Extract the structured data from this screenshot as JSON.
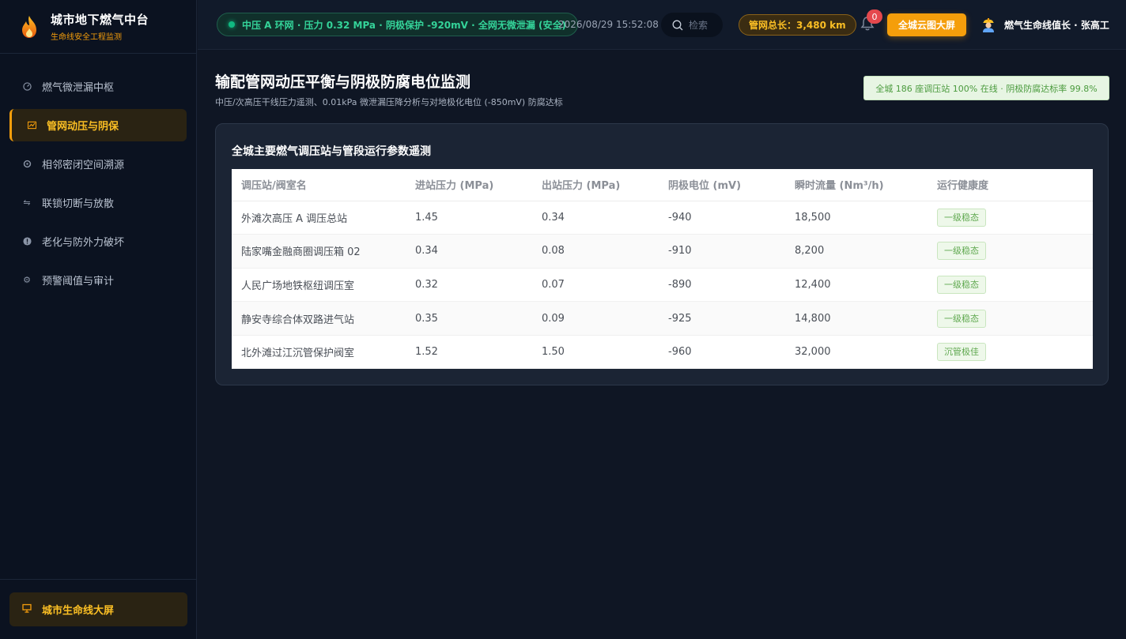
{
  "brand": {
    "title": "城市地下燃气中台",
    "subtitle": "生命线安全工程监测"
  },
  "sidebar": {
    "items": [
      {
        "label": "燃气微泄漏中枢",
        "icon": "gauge-icon",
        "active": false
      },
      {
        "label": "管网动压与阴保",
        "icon": "chart-icon",
        "active": true
      },
      {
        "label": "相邻密闭空间溯源",
        "icon": "crosshair-icon",
        "active": false
      },
      {
        "label": "联锁切断与放散",
        "icon": "swap-icon",
        "active": false
      },
      {
        "label": "老化与防外力破坏",
        "icon": "alert-icon",
        "active": false
      },
      {
        "label": "预警阈值与审计",
        "icon": "gear-icon",
        "active": false
      }
    ],
    "footer_button": "城市生命线大屏"
  },
  "header": {
    "status": "中压 A 环网 · 压力 0.32 MPa · 阴极保护 -920mV · 全网无微泄漏 (安全)",
    "timestamp": "2026/08/29 15:52:08",
    "search_placeholder": "检索",
    "pipe_length": "管网总长：3,480 km",
    "notifications": "0",
    "cloud_button": "全城云图大屏",
    "user": "燃气生命线值长 · 张高工"
  },
  "main": {
    "title": "输配管网动压平衡与阴极防腐电位监测",
    "subtitle": "中压/次高压干线压力遥测、0.01kPa 微泄漏压降分析与对地极化电位 (-850mV) 防腐达标",
    "online_badge": "全城 186 座调压站 100% 在线 · 阴极防腐达标率 99.8%",
    "panel_title": "全城主要燃气调压站与管段运行参数遥测",
    "table": {
      "headers": [
        "调压站/阀室名",
        "进站压力 (MPa)",
        "出站压力 (MPa)",
        "阴极电位 (mV)",
        "瞬时流量 (Nm³/h)",
        "运行健康度"
      ],
      "rows": [
        [
          "外滩次高压 A 调压总站",
          "1.45",
          "0.34",
          "-940",
          "18,500",
          "一级稳态"
        ],
        [
          "陆家嘴金融商圈调压箱 02",
          "0.34",
          "0.08",
          "-910",
          "8,200",
          "一级稳态"
        ],
        [
          "人民广场地铁枢纽调压室",
          "0.32",
          "0.07",
          "-890",
          "12,400",
          "一级稳态"
        ],
        [
          "静安寺综合体双路进气站",
          "0.35",
          "0.09",
          "-925",
          "14,800",
          "一级稳态"
        ],
        [
          "北外滩过江沉管保护阀室",
          "1.52",
          "1.50",
          "-960",
          "32,000",
          "沉管极佳"
        ]
      ]
    }
  },
  "colors": {
    "accent": "#f59e0b",
    "safe": "#34d399",
    "background": "#0f1624",
    "panel": "#1b2434"
  }
}
